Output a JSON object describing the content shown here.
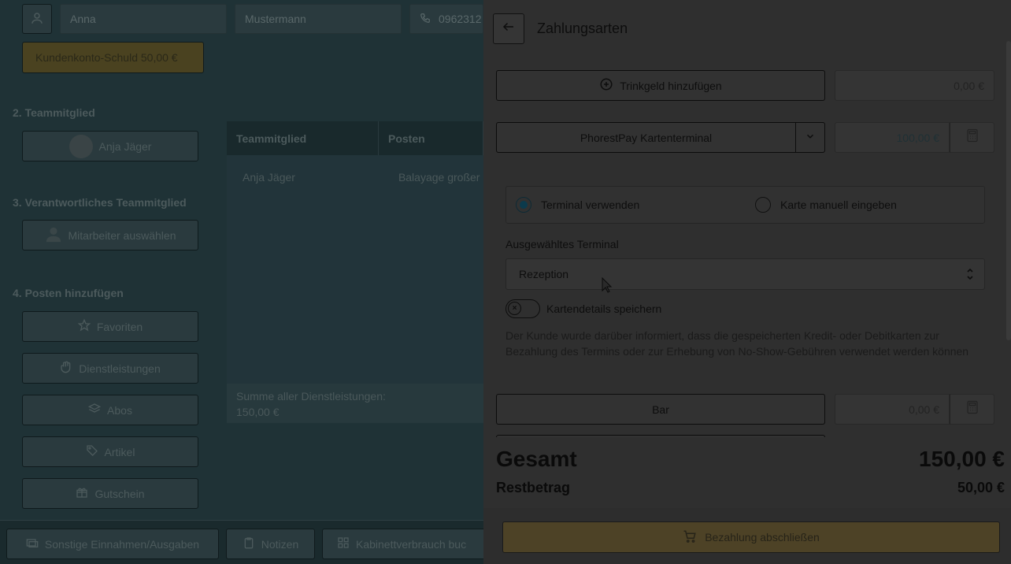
{
  "customer": {
    "first_name": "Anna",
    "last_name": "Mustermann",
    "phone": "0962312",
    "debt_badge": "Kundenkonto-Schuld 50,00 €"
  },
  "sections": {
    "team_member": "2. Teammitglied",
    "responsible": "3. Verantwortliches Teammitglied",
    "add_items": "4. Posten hinzufügen"
  },
  "team_member_button": "Anja Jäger",
  "responsible_button": "Mitarbeiter auswählen",
  "add_item_buttons": [
    "Favoriten",
    "Dienstleistungen",
    "Abos",
    "Artikel",
    "Gutschein"
  ],
  "table": {
    "headers": [
      "Teammitglied",
      "Posten"
    ],
    "row": [
      "Anja Jäger",
      "Balayage großer"
    ]
  },
  "sum": {
    "label": "Summe aller Dienstleistungen:",
    "value": "150,00 €"
  },
  "bottom_bar": [
    "Sonstige Einnahmen/Ausgaben",
    "Notizen",
    "Kabinettverbrauch buc"
  ],
  "drawer": {
    "title": "Zahlungsarten",
    "tip_button": "Trinkgeld hinzufügen",
    "tip_amount": "0,00 €",
    "terminal_button": "PhorestPay Kartenterminal",
    "terminal_amount": "100,00 €",
    "radio_options": [
      "Terminal verwenden",
      "Karte manuell eingeben"
    ],
    "selected_terminal_label": "Ausgewähltes Terminal",
    "selected_terminal_value": "Rezeption",
    "save_card_label": "Kartendetails speichern",
    "notice": "Der Kunde wurde darüber informiert, dass die gespeicherten Kredit- oder Debitkarten zur Bezahlung des Termins oder zur Erhebung von No-Show-Gebühren verwendet werden können",
    "cash_button": "Bar",
    "cash_amount": "0,00 €",
    "total_label": "Gesamt",
    "total_value": "150,00 €",
    "remaining_label": "Restbetrag",
    "remaining_value": "50,00 €",
    "finish_button": "Bezahlung abschließen"
  }
}
